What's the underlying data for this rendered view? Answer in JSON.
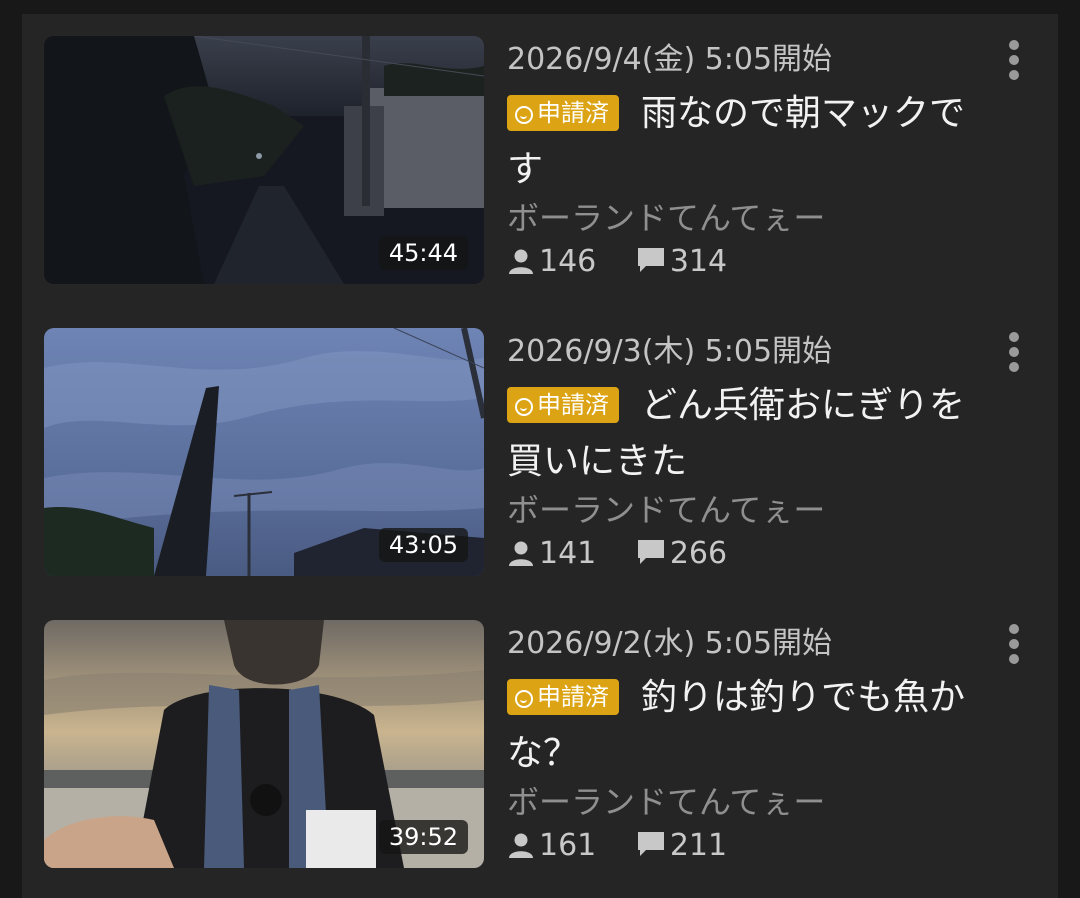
{
  "videos": [
    {
      "date": "2026/9/4(金) 5:05開始",
      "badge": "申請済",
      "title": "雨なので朝マックです",
      "channel": "ボーランドてんてぇー",
      "duration": "45:44",
      "viewers": "146",
      "comments": "314"
    },
    {
      "date": "2026/9/3(木) 5:05開始",
      "badge": "申請済",
      "title": "どん兵衛おにぎりを買いにきた",
      "channel": "ボーランドてんてぇー",
      "duration": "43:05",
      "viewers": "141",
      "comments": "266"
    },
    {
      "date": "2026/9/2(水) 5:05開始",
      "badge": "申請済",
      "title": "釣りは釣りでも魚かな？",
      "channel": "ボーランドてんてぇー",
      "duration": "39:52",
      "viewers": "161",
      "comments": "211"
    }
  ],
  "icons": {
    "viewers": "person-icon",
    "comments": "comment-icon",
    "more": "more-vert-icon",
    "badge": "smile-icon"
  },
  "colors": {
    "background": "#181818",
    "panel": "#252525",
    "badge": "#dca414"
  }
}
